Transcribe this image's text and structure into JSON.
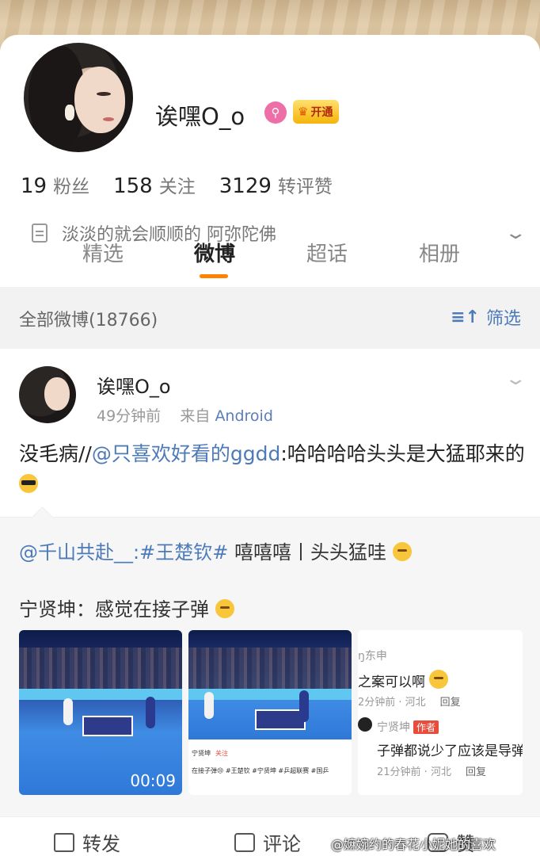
{
  "profile": {
    "username": "诶嘿O_o",
    "vip_label": "开通",
    "stats": [
      {
        "num": "19",
        "label": "粉丝"
      },
      {
        "num": "158",
        "label": "关注"
      },
      {
        "num": "3129",
        "label": "转评赞"
      }
    ],
    "bio": "淡淡的就会顺顺的 阿弥陀佛"
  },
  "tabs": [
    {
      "label": "精选",
      "active": false
    },
    {
      "label": "微博",
      "active": true
    },
    {
      "label": "超话",
      "active": false
    },
    {
      "label": "相册",
      "active": false
    }
  ],
  "section": {
    "count_label": "全部微博(18766)",
    "filter_label": "筛选"
  },
  "post": {
    "author": "诶嘿O_o",
    "time": "49分钟前",
    "source_prefix": "来自",
    "source": "Android",
    "text_before": "没毛病//",
    "mention": "@只喜欢好看的ggdd",
    "text_after": ":哈哈哈哈头头是大猛耶来的",
    "retweet": {
      "mention": "@千山共赴__",
      "hashtag": ":#王楚钦#",
      "text": " 嘻嘻嘻丨头头猛哇",
      "quote": "宁贤坤：感觉在接子弹"
    },
    "media": {
      "video_duration": "00:09",
      "m2_user": "宁贤坤",
      "m2_follow": "关注",
      "m2_text": "在接子弹😢 #王楚钦 #宁贤坤 #乒超联赛 #国乒",
      "c1_name": "ŋ东申",
      "c1_text": "之案可以啊",
      "c1_meta": "2分钟前 · 河北",
      "reply": "回复",
      "c2_name": "宁贤坤",
      "c2_tag": "作者",
      "c2_text": "子弹都说少了应该是导弹",
      "c2_meta": "21分钟前 · 河北"
    }
  },
  "actions": {
    "repost": "转发",
    "comment": "评论",
    "like": "赞"
  },
  "watermark": "@嫲婉约的春花小妮她的喜欢"
}
